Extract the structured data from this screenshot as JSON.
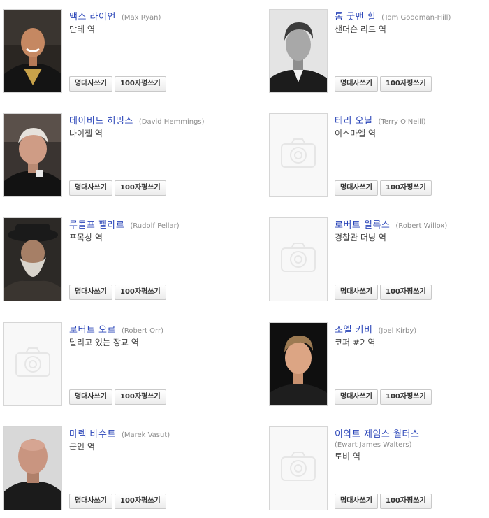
{
  "buttons": {
    "quote": "명대사쓰기",
    "review": "100자평쓰기"
  },
  "cast": [
    {
      "name_ko": "맥스 라이언",
      "name_en": "(Max Ryan)",
      "role": "단테 역",
      "photo": "man-smiling-dark-jacket"
    },
    {
      "name_ko": "톰 굿맨 힐",
      "name_en": "(Tom Goodman-Hill)",
      "role": "샌더슨 리드 역",
      "photo": "man-bw-portrait"
    },
    {
      "name_ko": "데이비드 허밍스",
      "name_en": "(David Hemmings)",
      "role": "나이젤 역",
      "photo": "older-man-white-hair"
    },
    {
      "name_ko": "테리 오닐",
      "name_en": "(Terry O'Neill)",
      "role": "이스마엘 역",
      "photo": "placeholder"
    },
    {
      "name_ko": "루돌프 펠라르",
      "name_en": "(Rudolf Pellar)",
      "role": "포목상 역",
      "photo": "old-man-hat-beard"
    },
    {
      "name_ko": "로버트 윌록스",
      "name_en": "(Robert Willox)",
      "role": "경찰관 더닝 역",
      "photo": "placeholder"
    },
    {
      "name_ko": "로버트 오르",
      "name_en": "(Robert Orr)",
      "role": "달리고 있는 장교 역",
      "photo": "placeholder"
    },
    {
      "name_ko": "조엘 커비",
      "name_en": "(Joel Kirby)",
      "role": "코퍼 #2 역",
      "photo": "man-blond-dark-background"
    },
    {
      "name_ko": "마렉 바수트",
      "name_en": "(Marek Vasut)",
      "role": "군인 역",
      "photo": "bald-man-dark-clothes"
    },
    {
      "name_ko": "이와트 제임스 월터스",
      "name_en": "(Ewart James Walters)",
      "role": "토비 역",
      "photo": "placeholder",
      "english_on_second_line": true
    }
  ]
}
